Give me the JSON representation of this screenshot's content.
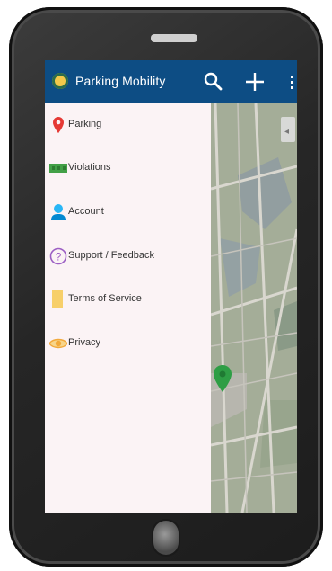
{
  "app": {
    "title": "Parking Mobility"
  },
  "drawer": {
    "items": [
      {
        "label": "Parking",
        "icon": "map-pin-icon",
        "color": "#e53935"
      },
      {
        "label": "Violations",
        "icon": "ticket-icon",
        "color": "#43a047"
      },
      {
        "label": "Account",
        "icon": "person-icon",
        "color": "#29b6f6"
      },
      {
        "label": "Support / Feedback",
        "icon": "help-icon",
        "color": "#9c5fc4"
      },
      {
        "label": "Terms of Service",
        "icon": "document-icon",
        "color": "#f7cf6a"
      },
      {
        "label": "Privacy",
        "icon": "eye-icon",
        "color": "#f2a93b"
      }
    ]
  },
  "colors": {
    "appbar": "#0d4d84",
    "drawer_bg": "#fbf3f5",
    "map_marker": "#2e9e45"
  }
}
